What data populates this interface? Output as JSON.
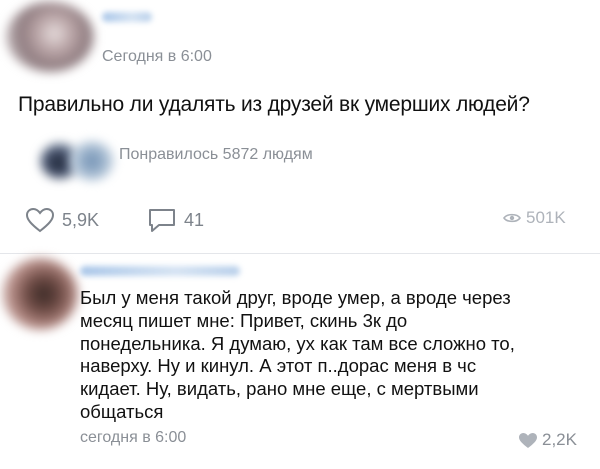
{
  "post": {
    "meta": "Сегодня в 6:00",
    "text": "Правильно ли удалять из друзей вк умерших людей?",
    "liked_by": "Понравилось 5872 людям",
    "actions": {
      "likes": "5,9K",
      "comments": "41",
      "views": "501K"
    }
  },
  "comment": {
    "lines": [
      "Был у меня такой друг, вроде умер, а вроде через",
      "месяц пишет мне: Привет, скинь 3к до",
      "понедельника. Я думаю, ух как там все сложно то,",
      "наверху. Ну и кинул. А этот п..дорас меня в чс",
      "кидает. Ну, видать, рано мне еще, с мертвыми",
      "общаться"
    ],
    "meta": "сегодня в 6:00",
    "likes": "2,2K"
  },
  "icons": {
    "like": "heart-icon",
    "comment": "comment-icon",
    "views": "eye-icon"
  }
}
